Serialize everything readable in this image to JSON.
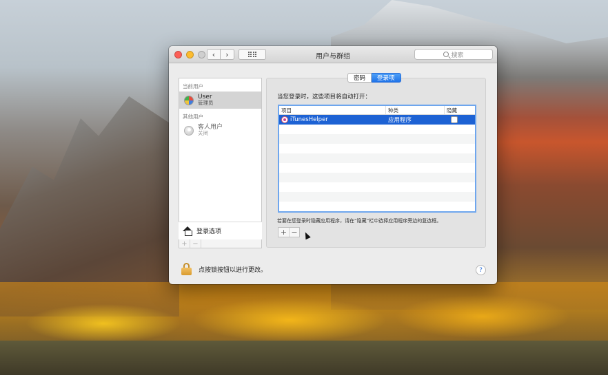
{
  "window": {
    "title": "用户与群组",
    "search_placeholder": "搜索"
  },
  "sidebar": {
    "current_users_label": "当前用户",
    "current_user": {
      "name": "User",
      "role": "管理员"
    },
    "other_users_label": "其他用户",
    "other_user": {
      "name": "客人用户",
      "status": "关闭"
    },
    "login_options_label": "登录选项",
    "add_label": "+",
    "remove_label": "−"
  },
  "tabs": [
    {
      "label": "密码",
      "active": false
    },
    {
      "label": "登录项",
      "active": true
    }
  ],
  "login_items": {
    "heading": "当您登录时，这些项目将自动打开：",
    "columns": [
      "项目",
      "种类",
      "隐藏"
    ],
    "rows": [
      {
        "item": "iTunesHelper",
        "kind": "应用程序",
        "hidden": false,
        "selected": true
      }
    ],
    "note": "若要在您登录时隐藏应用程序，请在“隐藏”栏中选择应用程序旁边的复选框。",
    "add_label": "+",
    "remove_label": "−"
  },
  "footer": {
    "lock_text": "点按锁按钮以进行更改。",
    "help_label": "?"
  },
  "colors": {
    "accent": "#1d62d4",
    "tab_active": "#2073e8"
  }
}
